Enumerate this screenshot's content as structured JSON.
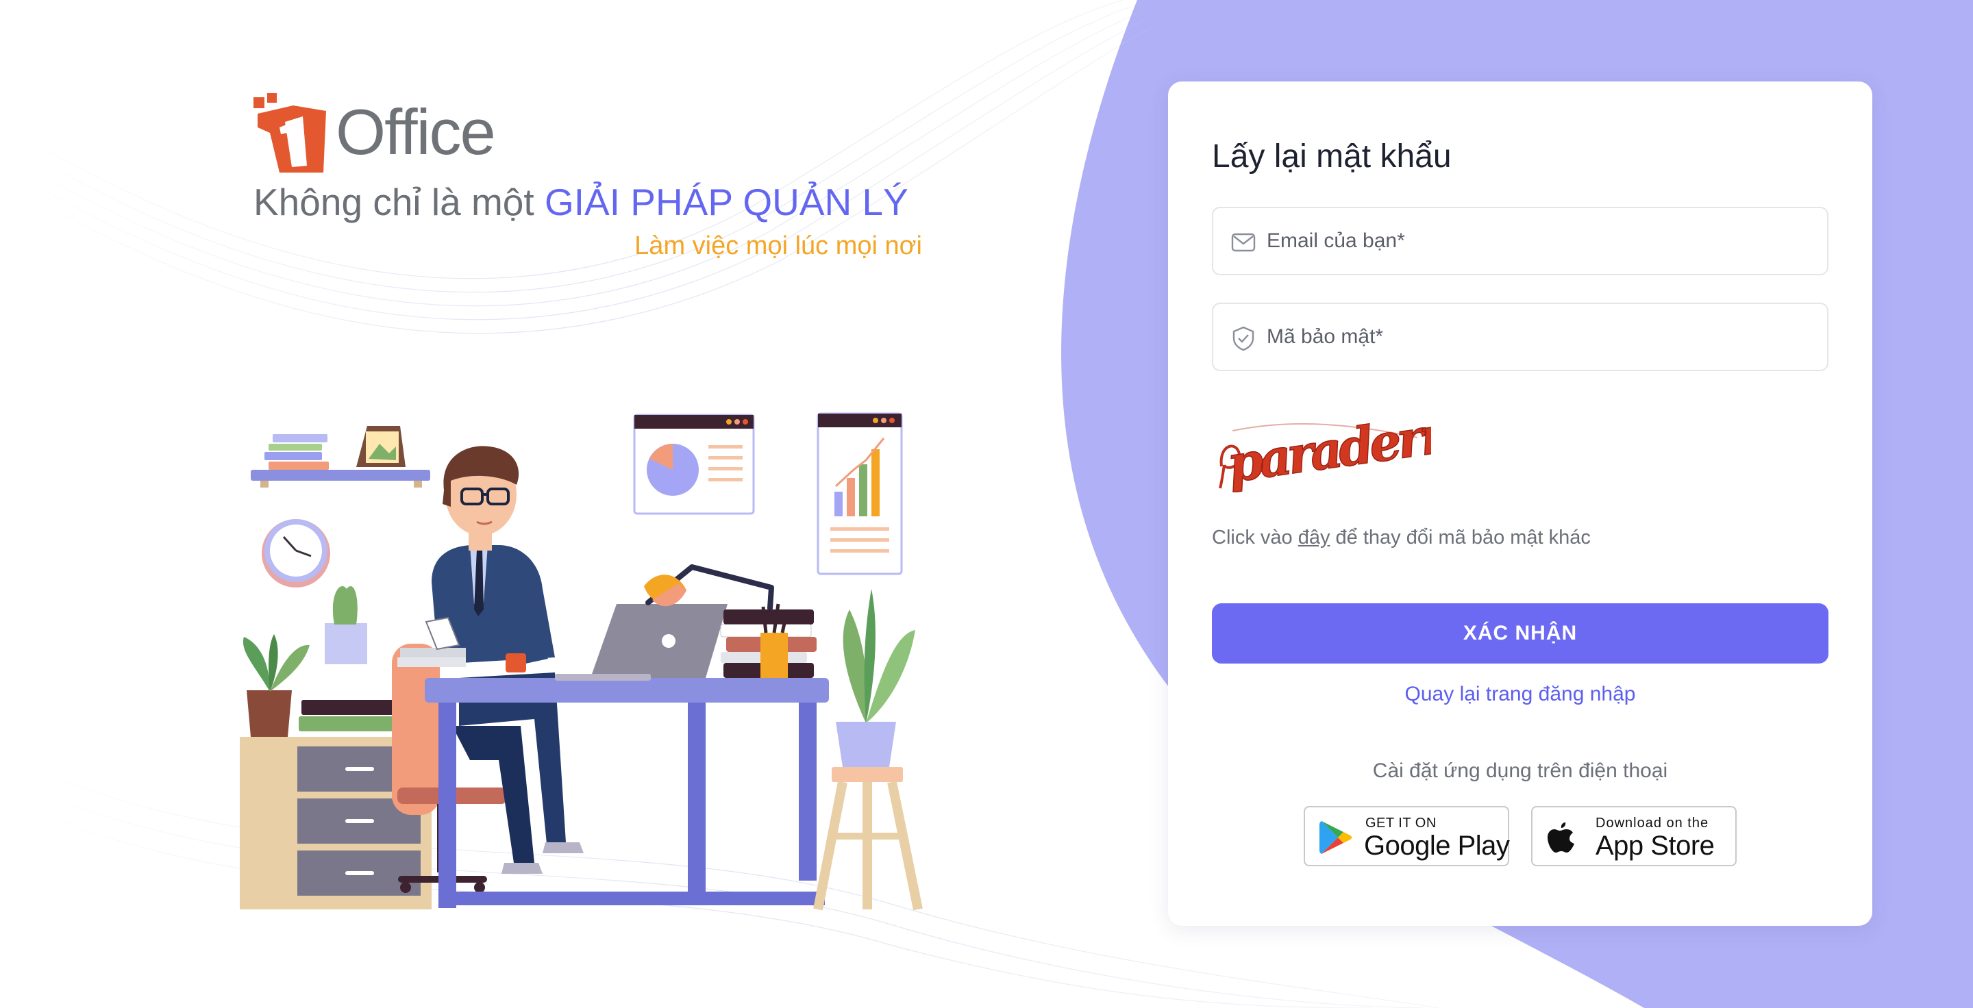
{
  "colors": {
    "accent": "#6c6af3",
    "accent_light": "#b0b0f7",
    "orange": "#f5a524",
    "logo_red": "#e4582f",
    "text_gray": "#6b6f76"
  },
  "brand": {
    "logo_text": "Office",
    "tagline_prefix": "Không chỉ là một",
    "tagline_highlight": "GIẢI PHÁP QUẢN LÝ",
    "subtagline": "Làm việc mọi lúc mọi nơi"
  },
  "form": {
    "title": "Lấy lại mật khẩu",
    "email_placeholder": "Email của bạn*",
    "email_icon": "envelope-icon",
    "security_placeholder": "Mã bảo mật*",
    "security_icon": "shield-check-icon",
    "captcha_text": "paraderm",
    "captcha_help_prefix": "Click vào",
    "captcha_help_link": "đây",
    "captcha_help_suffix": "để thay đổi mã bảo mật khác",
    "submit_label": "XÁC NHẬN",
    "back_link": "Quay lại trang đăng nhập"
  },
  "apps": {
    "label": "Cài đặt ứng dụng trên điện thoại",
    "google_play": {
      "small": "GET IT ON",
      "big": "Google Play",
      "icon": "google-play-icon"
    },
    "app_store": {
      "small": "Download on the",
      "big": "App Store",
      "icon": "apple-icon"
    }
  }
}
